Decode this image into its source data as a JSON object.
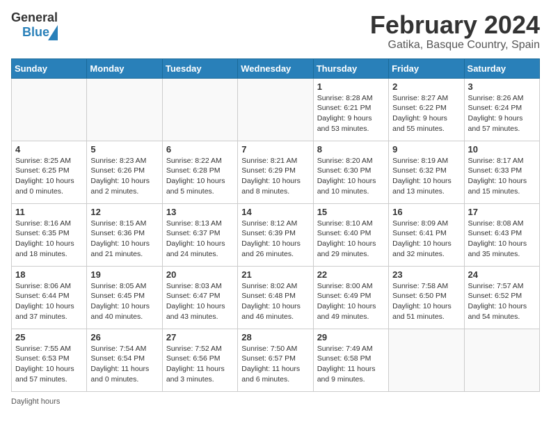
{
  "header": {
    "logo_line1": "General",
    "logo_line2": "Blue",
    "title": "February 2024",
    "subtitle": "Gatika, Basque Country, Spain"
  },
  "days_of_week": [
    "Sunday",
    "Monday",
    "Tuesday",
    "Wednesday",
    "Thursday",
    "Friday",
    "Saturday"
  ],
  "weeks": [
    [
      {
        "day": "",
        "info": ""
      },
      {
        "day": "",
        "info": ""
      },
      {
        "day": "",
        "info": ""
      },
      {
        "day": "",
        "info": ""
      },
      {
        "day": "1",
        "info": "Sunrise: 8:28 AM\nSunset: 6:21 PM\nDaylight: 9 hours\nand 53 minutes."
      },
      {
        "day": "2",
        "info": "Sunrise: 8:27 AM\nSunset: 6:22 PM\nDaylight: 9 hours\nand 55 minutes."
      },
      {
        "day": "3",
        "info": "Sunrise: 8:26 AM\nSunset: 6:24 PM\nDaylight: 9 hours\nand 57 minutes."
      }
    ],
    [
      {
        "day": "4",
        "info": "Sunrise: 8:25 AM\nSunset: 6:25 PM\nDaylight: 10 hours\nand 0 minutes."
      },
      {
        "day": "5",
        "info": "Sunrise: 8:23 AM\nSunset: 6:26 PM\nDaylight: 10 hours\nand 2 minutes."
      },
      {
        "day": "6",
        "info": "Sunrise: 8:22 AM\nSunset: 6:28 PM\nDaylight: 10 hours\nand 5 minutes."
      },
      {
        "day": "7",
        "info": "Sunrise: 8:21 AM\nSunset: 6:29 PM\nDaylight: 10 hours\nand 8 minutes."
      },
      {
        "day": "8",
        "info": "Sunrise: 8:20 AM\nSunset: 6:30 PM\nDaylight: 10 hours\nand 10 minutes."
      },
      {
        "day": "9",
        "info": "Sunrise: 8:19 AM\nSunset: 6:32 PM\nDaylight: 10 hours\nand 13 minutes."
      },
      {
        "day": "10",
        "info": "Sunrise: 8:17 AM\nSunset: 6:33 PM\nDaylight: 10 hours\nand 15 minutes."
      }
    ],
    [
      {
        "day": "11",
        "info": "Sunrise: 8:16 AM\nSunset: 6:35 PM\nDaylight: 10 hours\nand 18 minutes."
      },
      {
        "day": "12",
        "info": "Sunrise: 8:15 AM\nSunset: 6:36 PM\nDaylight: 10 hours\nand 21 minutes."
      },
      {
        "day": "13",
        "info": "Sunrise: 8:13 AM\nSunset: 6:37 PM\nDaylight: 10 hours\nand 24 minutes."
      },
      {
        "day": "14",
        "info": "Sunrise: 8:12 AM\nSunset: 6:39 PM\nDaylight: 10 hours\nand 26 minutes."
      },
      {
        "day": "15",
        "info": "Sunrise: 8:10 AM\nSunset: 6:40 PM\nDaylight: 10 hours\nand 29 minutes."
      },
      {
        "day": "16",
        "info": "Sunrise: 8:09 AM\nSunset: 6:41 PM\nDaylight: 10 hours\nand 32 minutes."
      },
      {
        "day": "17",
        "info": "Sunrise: 8:08 AM\nSunset: 6:43 PM\nDaylight: 10 hours\nand 35 minutes."
      }
    ],
    [
      {
        "day": "18",
        "info": "Sunrise: 8:06 AM\nSunset: 6:44 PM\nDaylight: 10 hours\nand 37 minutes."
      },
      {
        "day": "19",
        "info": "Sunrise: 8:05 AM\nSunset: 6:45 PM\nDaylight: 10 hours\nand 40 minutes."
      },
      {
        "day": "20",
        "info": "Sunrise: 8:03 AM\nSunset: 6:47 PM\nDaylight: 10 hours\nand 43 minutes."
      },
      {
        "day": "21",
        "info": "Sunrise: 8:02 AM\nSunset: 6:48 PM\nDaylight: 10 hours\nand 46 minutes."
      },
      {
        "day": "22",
        "info": "Sunrise: 8:00 AM\nSunset: 6:49 PM\nDaylight: 10 hours\nand 49 minutes."
      },
      {
        "day": "23",
        "info": "Sunrise: 7:58 AM\nSunset: 6:50 PM\nDaylight: 10 hours\nand 51 minutes."
      },
      {
        "day": "24",
        "info": "Sunrise: 7:57 AM\nSunset: 6:52 PM\nDaylight: 10 hours\nand 54 minutes."
      }
    ],
    [
      {
        "day": "25",
        "info": "Sunrise: 7:55 AM\nSunset: 6:53 PM\nDaylight: 10 hours\nand 57 minutes."
      },
      {
        "day": "26",
        "info": "Sunrise: 7:54 AM\nSunset: 6:54 PM\nDaylight: 11 hours\nand 0 minutes."
      },
      {
        "day": "27",
        "info": "Sunrise: 7:52 AM\nSunset: 6:56 PM\nDaylight: 11 hours\nand 3 minutes."
      },
      {
        "day": "28",
        "info": "Sunrise: 7:50 AM\nSunset: 6:57 PM\nDaylight: 11 hours\nand 6 minutes."
      },
      {
        "day": "29",
        "info": "Sunrise: 7:49 AM\nSunset: 6:58 PM\nDaylight: 11 hours\nand 9 minutes."
      },
      {
        "day": "",
        "info": ""
      },
      {
        "day": "",
        "info": ""
      }
    ]
  ],
  "footer": {
    "daylight_label": "Daylight hours"
  }
}
